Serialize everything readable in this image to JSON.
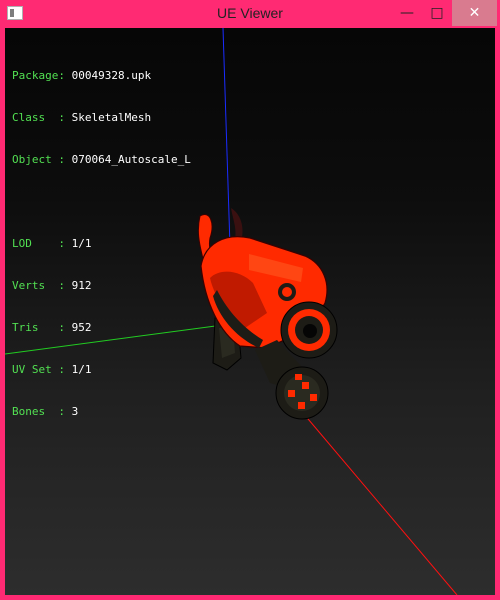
{
  "window": {
    "title": "UE Viewer",
    "controls": {
      "minimize": "—",
      "maximize": "□",
      "close": "✕"
    }
  },
  "info": [
    {
      "key": "Package:",
      "value": "00049328.upk"
    },
    {
      "key": "Class  :",
      "value": "SkeletalMesh"
    },
    {
      "key": "Object :",
      "value": "070064_Autoscale_L"
    },
    {
      "key": "LOD    :",
      "value": "1/1"
    },
    {
      "key": "Verts  :",
      "value": "912"
    },
    {
      "key": "Tris   :",
      "value": "952"
    },
    {
      "key": "UV Set :",
      "value": "1/1"
    },
    {
      "key": "Bones  :",
      "value": "3"
    }
  ],
  "colors": {
    "frame": "#ff2a73",
    "label": "#52e052",
    "value": "#ffffff",
    "axis_x": "#ff1010",
    "axis_y": "#22cc22",
    "axis_z": "#1a2cff",
    "mesh_primary": "#ff2a00",
    "mesh_dark": "#1a1a14"
  },
  "icons": {
    "app": "ue-viewer-icon"
  }
}
